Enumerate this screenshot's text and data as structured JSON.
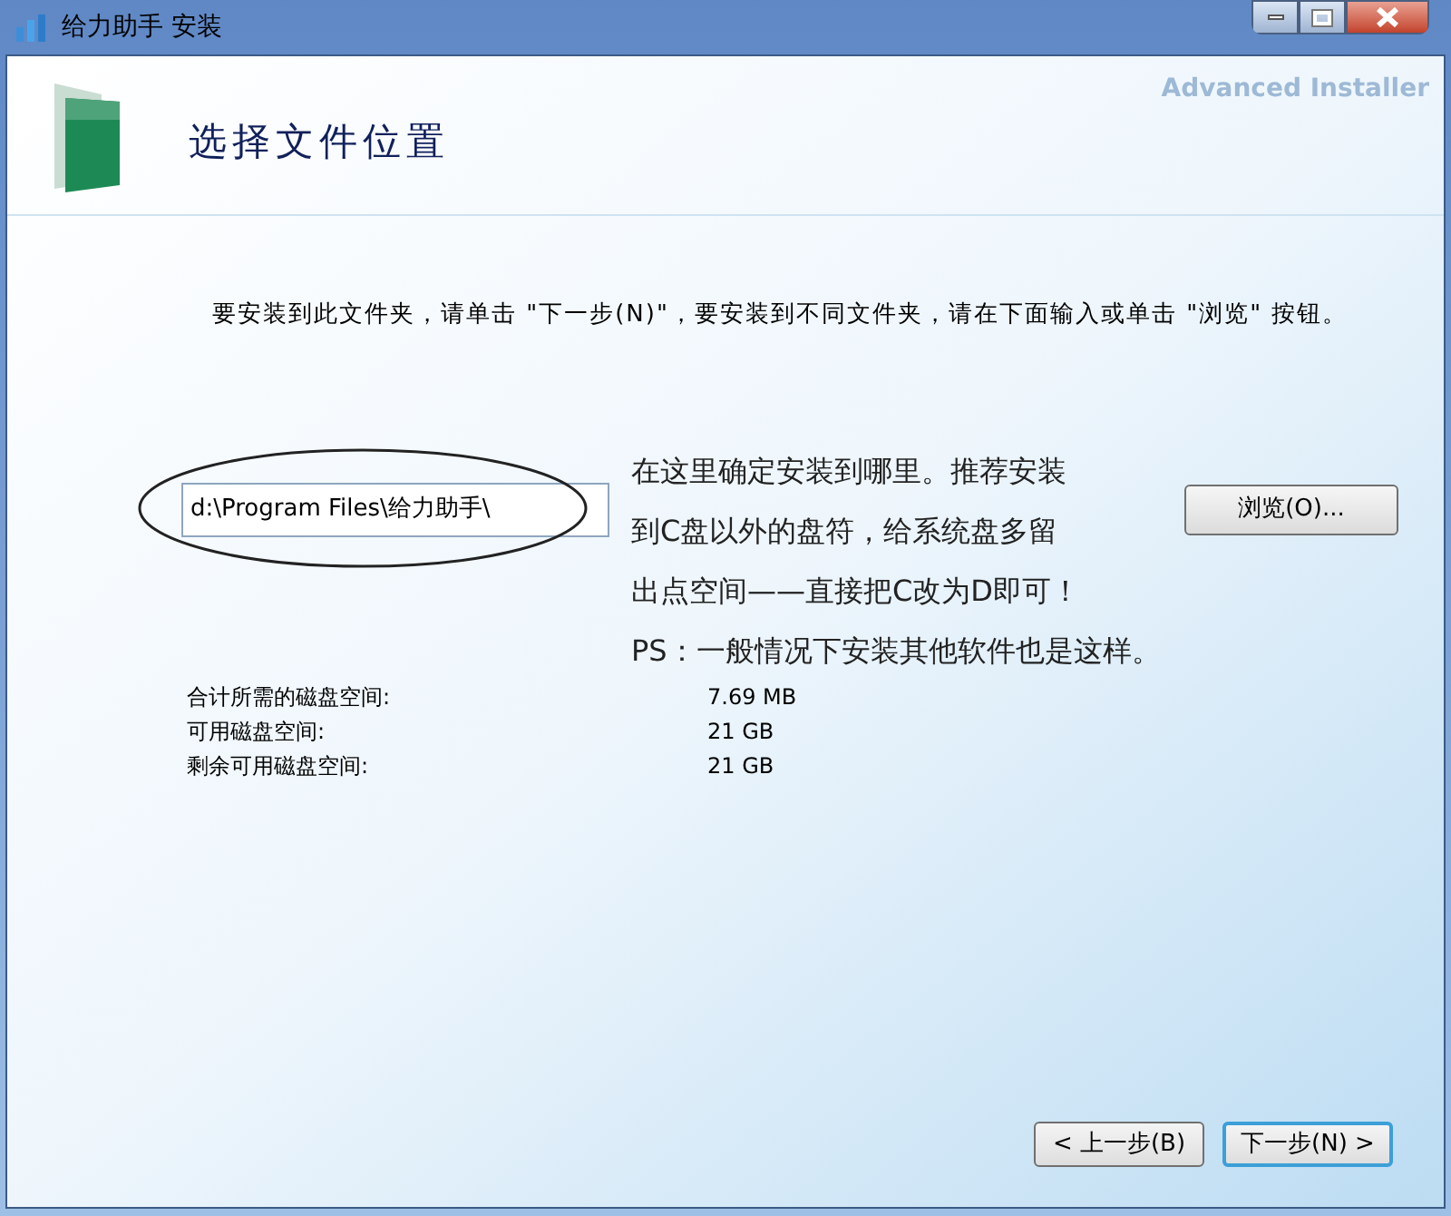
{
  "window": {
    "title": "给力助手 安装",
    "controls": [
      {
        "kind": "minimize"
      },
      {
        "kind": "maximize"
      },
      {
        "kind": "close"
      }
    ]
  },
  "header": {
    "brand": "Advanced Installer",
    "title": "选择文件位置"
  },
  "instruction": "要安装到此文件夹，请单击 \"下一步(N)\"，要安装到不同文件夹，请在下面输入或单击 \"浏览\" 按钮。",
  "path_field": {
    "value": "d:\\Program Files\\给力助手\\"
  },
  "browse_button": "浏览(O)...",
  "annotation": [
    "在这里确定安装到哪里。推荐安装",
    "到C盘以外的盘符，给系统盘多留",
    "出点空间——直接把C改为D即可！",
    "PS：一般情况下安装其他软件也是这样。"
  ],
  "disk_info": [
    {
      "label": "合计所需的磁盘空间:",
      "value": "7.69 MB"
    },
    {
      "label": "可用磁盘空间:",
      "value": "21 GB"
    },
    {
      "label": "剩余可用磁盘空间:",
      "value": "21 GB"
    }
  ],
  "buttons": [
    {
      "label": "< 上一步(B)",
      "selected": false
    },
    {
      "label": "下一步(N) >",
      "selected": true
    }
  ]
}
